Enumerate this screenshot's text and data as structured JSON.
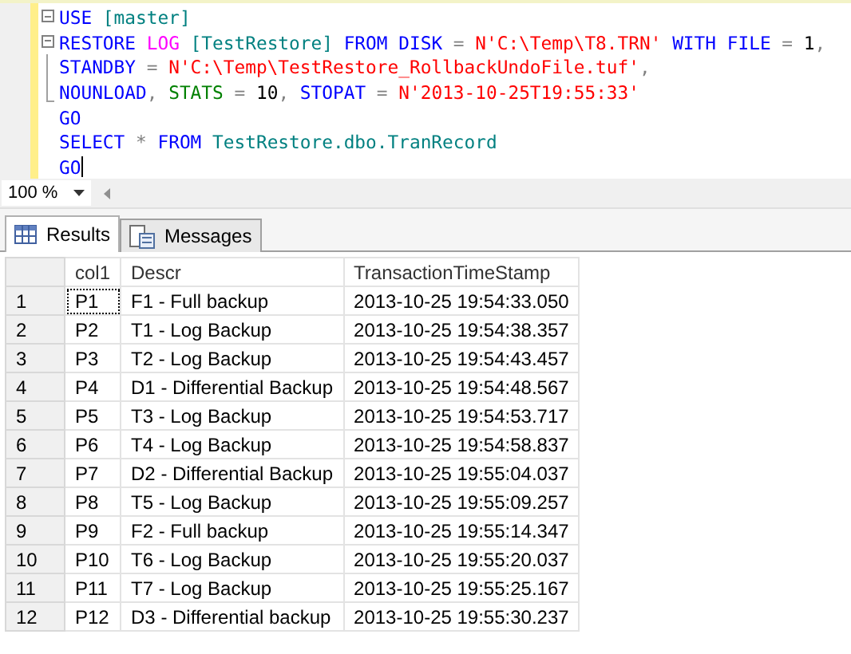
{
  "editor": {
    "lines": [
      {
        "kind": "block",
        "expanded": true,
        "tokens": [
          {
            "kind": "keyword",
            "text": "USE"
          },
          {
            "kind": "identifier",
            "text": " [master]"
          }
        ]
      },
      {
        "kind": "block",
        "expanded": true,
        "tokens": [
          {
            "kind": "keyword",
            "text": "RESTORE"
          },
          {
            "kind": "special",
            "text": " LOG"
          },
          {
            "kind": "identifier",
            "text": " [TestRestore]"
          },
          {
            "kind": "keyword",
            "text": " FROM DISK"
          },
          {
            "kind": "operator",
            "text": " ="
          },
          {
            "kind": "string",
            "text": " N'C:\\Temp\\T8.TRN'"
          },
          {
            "kind": "keyword",
            "text": " WITH FILE"
          },
          {
            "kind": "operator",
            "text": " ="
          },
          {
            "kind": "plain",
            "text": " 1"
          },
          {
            "kind": "operator",
            "text": ","
          }
        ],
        "children": [
          {
            "tokens": [
              {
                "kind": "keyword",
                "text": "STANDBY"
              },
              {
                "kind": "operator",
                "text": " ="
              },
              {
                "kind": "string",
                "text": " N'C:\\Temp\\TestRestore_RollbackUndoFile.tuf'"
              },
              {
                "kind": "operator",
                "text": ","
              }
            ]
          },
          {
            "tokens": [
              {
                "kind": "keyword",
                "text": "NOUNLOAD"
              },
              {
                "kind": "operator",
                "text": ","
              },
              {
                "kind": "function",
                "text": " STATS"
              },
              {
                "kind": "operator",
                "text": " ="
              },
              {
                "kind": "plain",
                "text": " 10"
              },
              {
                "kind": "operator",
                "text": ","
              },
              {
                "kind": "keyword",
                "text": " STOPAT"
              },
              {
                "kind": "operator",
                "text": " ="
              },
              {
                "kind": "string",
                "text": " N'2013-10-25T19:55:33'"
              }
            ]
          }
        ]
      },
      {
        "kind": "line",
        "tokens": [
          {
            "kind": "keyword",
            "text": "GO"
          }
        ]
      },
      {
        "kind": "line",
        "tokens": [
          {
            "kind": "keyword",
            "text": "SELECT"
          },
          {
            "kind": "operator",
            "text": " *"
          },
          {
            "kind": "keyword",
            "text": " FROM"
          },
          {
            "kind": "identifier",
            "text": " TestRestore.dbo.TranRecord"
          }
        ]
      },
      {
        "kind": "line",
        "tokens": [
          {
            "kind": "keyword",
            "text": "GO"
          }
        ]
      }
    ]
  },
  "zoom": {
    "value": "100 %"
  },
  "tabs": [
    {
      "label": "Results",
      "selected": true
    },
    {
      "label": "Messages",
      "selected": false
    }
  ],
  "table": {
    "columns": [
      "col1",
      "Descr",
      "TransactionTimeStamp"
    ],
    "rows": [
      {
        "number": "1",
        "cells": [
          "P1",
          "F1 - Full backup",
          "2013-10-25 19:54:33.050"
        ],
        "focused": true
      },
      {
        "number": "2",
        "cells": [
          "P2",
          "T1 - Log Backup",
          "2013-10-25 19:54:38.357"
        ],
        "focused": false
      },
      {
        "number": "3",
        "cells": [
          "P3",
          "T2 - Log Backup",
          "2013-10-25 19:54:43.457"
        ],
        "focused": false
      },
      {
        "number": "4",
        "cells": [
          "P4",
          "D1 - Differential Backup",
          "2013-10-25 19:54:48.567"
        ],
        "focused": false
      },
      {
        "number": "5",
        "cells": [
          "P5",
          "T3 - Log Backup",
          "2013-10-25 19:54:53.717"
        ],
        "focused": false
      },
      {
        "number": "6",
        "cells": [
          "P6",
          "T4 - Log Backup",
          "2013-10-25 19:54:58.837"
        ],
        "focused": false
      },
      {
        "number": "7",
        "cells": [
          "P7",
          "D2 - Differential Backup",
          "2013-10-25 19:55:04.037"
        ],
        "focused": false
      },
      {
        "number": "8",
        "cells": [
          "P8",
          "T5 - Log Backup",
          "2013-10-25 19:55:09.257"
        ],
        "focused": false
      },
      {
        "number": "9",
        "cells": [
          "P9",
          "F2 - Full backup",
          "2013-10-25 19:55:14.347"
        ],
        "focused": false
      },
      {
        "number": "10",
        "cells": [
          "P10",
          "T6 - Log Backup",
          "2013-10-25 19:55:20.037"
        ],
        "focused": false
      },
      {
        "number": "11",
        "cells": [
          "P11",
          "T7 - Log Backup",
          "2013-10-25 19:55:25.167"
        ],
        "focused": false
      },
      {
        "number": "12",
        "cells": [
          "P12",
          "D3 - Differential backup",
          "2013-10-25 19:55:30.237"
        ],
        "focused": false
      }
    ]
  }
}
